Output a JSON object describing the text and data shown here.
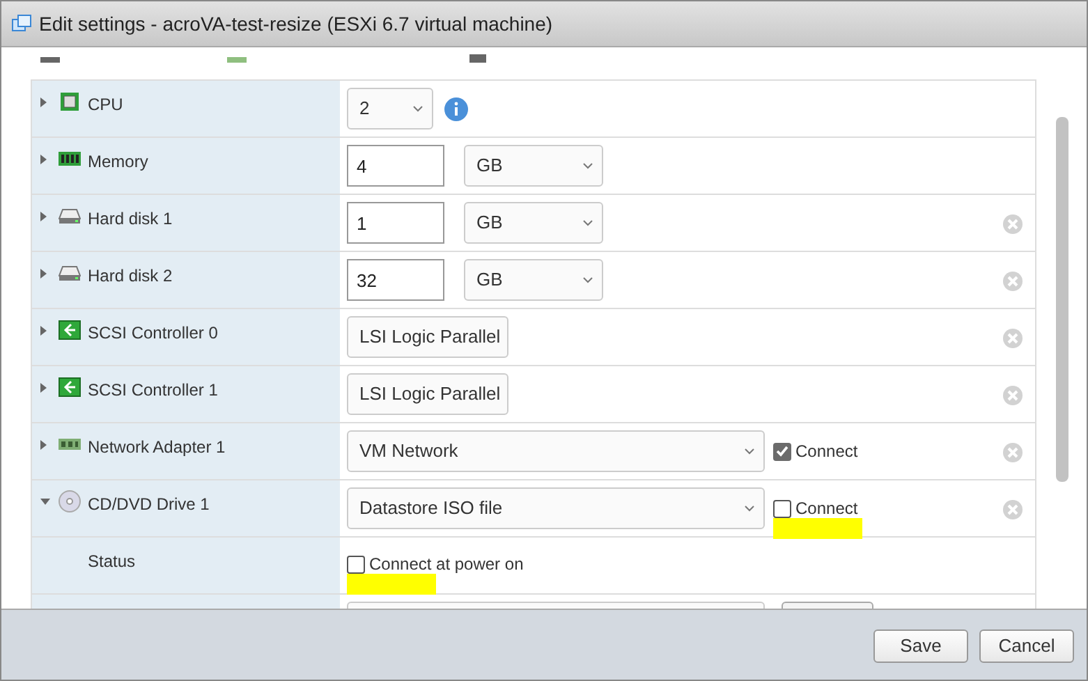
{
  "window": {
    "title": "Edit settings - acroVA-test-resize (ESXi 6.7 virtual machine)"
  },
  "rows": [
    {
      "kind": "select",
      "label": "CPU",
      "expanded": false,
      "value": "2",
      "info": true,
      "removable": false
    },
    {
      "kind": "number_unit",
      "label": "Memory",
      "expanded": false,
      "value": "4",
      "unit": "GB",
      "removable": false
    },
    {
      "kind": "number_unit",
      "label": "Hard disk 1",
      "expanded": false,
      "value": "1",
      "unit": "GB",
      "removable": true
    },
    {
      "kind": "number_unit",
      "label": "Hard disk 2",
      "expanded": false,
      "value": "32",
      "unit": "GB",
      "removable": true
    },
    {
      "kind": "select",
      "label": "SCSI Controller 0",
      "expanded": false,
      "value": "LSI Logic Parallel",
      "removable": true
    },
    {
      "kind": "select",
      "label": "SCSI Controller 1",
      "expanded": false,
      "value": "LSI Logic Parallel",
      "removable": true
    },
    {
      "kind": "select_connect",
      "label": "Network Adapter 1",
      "expanded": false,
      "value": "VM Network",
      "connect": {
        "label": "Connect",
        "checked": true,
        "highlighted": false
      },
      "removable": true
    },
    {
      "kind": "select_connect",
      "label": "CD/DVD Drive 1",
      "expanded": true,
      "value": "Datastore ISO file",
      "connect": {
        "label": "Connect",
        "checked": false,
        "highlighted": true
      },
      "removable": true
    },
    {
      "kind": "check",
      "label": "Status",
      "connect": {
        "label": "Connect at power on",
        "checked": false,
        "highlighted": true
      }
    }
  ],
  "buttons": [
    {
      "label": "Save"
    },
    {
      "label": "Cancel"
    }
  ]
}
